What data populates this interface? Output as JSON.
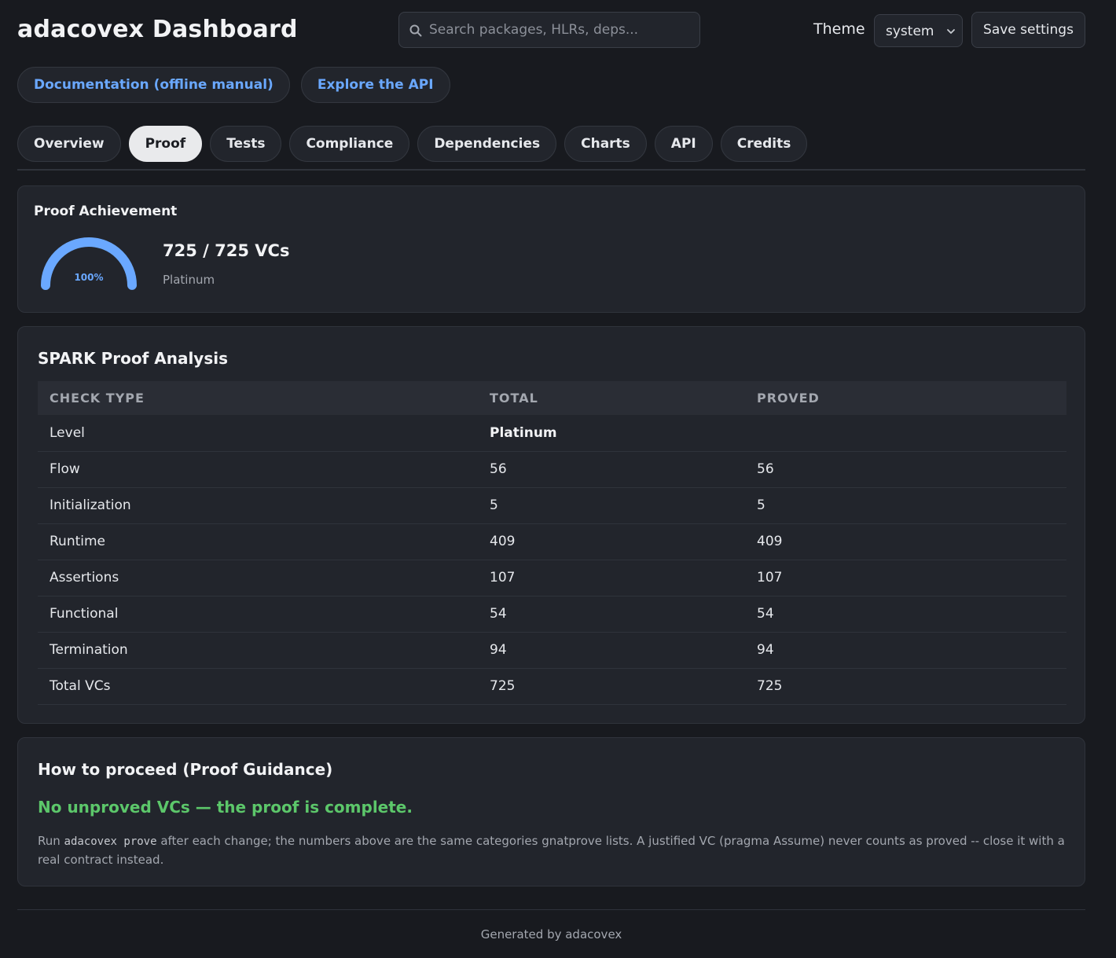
{
  "header": {
    "title": "adacovex Dashboard",
    "search_placeholder": "Search packages, HLRs, deps...",
    "theme_label": "Theme",
    "theme_value": "system",
    "save_label": "Save settings"
  },
  "links": [
    {
      "label": "Documentation (offline manual)"
    },
    {
      "label": "Explore the API"
    }
  ],
  "tabs": [
    {
      "label": "Overview",
      "active": false
    },
    {
      "label": "Proof",
      "active": true
    },
    {
      "label": "Tests",
      "active": false
    },
    {
      "label": "Compliance",
      "active": false
    },
    {
      "label": "Dependencies",
      "active": false
    },
    {
      "label": "Charts",
      "active": false
    },
    {
      "label": "API",
      "active": false
    },
    {
      "label": "Credits",
      "active": false
    }
  ],
  "achievement": {
    "title": "Proof Achievement",
    "gauge_percent": "100%",
    "gauge_fraction": 1.0,
    "vcs": "725 / 725 VCs",
    "level": "Platinum",
    "accent_color": "#6aa8ff"
  },
  "analysis": {
    "title": "SPARK Proof Analysis",
    "headers": [
      "CHECK TYPE",
      "TOTAL",
      "PROVED"
    ],
    "level_row": {
      "label": "Level",
      "value": "Platinum"
    },
    "rows": [
      {
        "type": "Flow",
        "total": "56",
        "proved": "56"
      },
      {
        "type": "Initialization",
        "total": "5",
        "proved": "5"
      },
      {
        "type": "Runtime",
        "total": "409",
        "proved": "409"
      },
      {
        "type": "Assertions",
        "total": "107",
        "proved": "107"
      },
      {
        "type": "Functional",
        "total": "54",
        "proved": "54"
      },
      {
        "type": "Termination",
        "total": "94",
        "proved": "94"
      },
      {
        "type": "Total VCs",
        "total": "725",
        "proved": "725"
      }
    ]
  },
  "guidance": {
    "title": "How to proceed (Proof Guidance)",
    "status": "No unproved VCs — the proof is complete.",
    "note_prefix": "Run ",
    "note_command": "adacovex prove",
    "note_suffix": " after each change; the numbers above are the same categories gnatprove lists. A justified VC (pragma Assume) never counts as proved -- close it with a real contract instead.",
    "status_color": "#5cc76a"
  },
  "footer": {
    "text": "Generated by adacovex"
  }
}
